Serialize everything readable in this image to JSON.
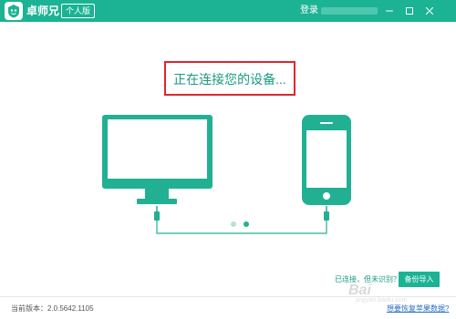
{
  "titlebar": {
    "app_title": "卓师兄",
    "edition": "个人版",
    "login": "登录",
    "background": "#1bb394"
  },
  "window_controls": {
    "minimize_icon": "minimize-icon",
    "maximize_icon": "maximize-icon",
    "close_icon": "close-icon"
  },
  "main": {
    "status": "正在连接您的设备...",
    "connected_hint": "已连接，但未识别？",
    "import_button": "备份导入"
  },
  "footer": {
    "version": "当前版本：2.0.5642.1105",
    "recover_link": "想要恢复苹果数据?"
  },
  "watermark": {
    "main": "Bai",
    "sub": "jingyan.baidu.com"
  },
  "colors": {
    "accent": "#1bb394",
    "device": "#22b093",
    "highlight_box": "#e2252c"
  }
}
